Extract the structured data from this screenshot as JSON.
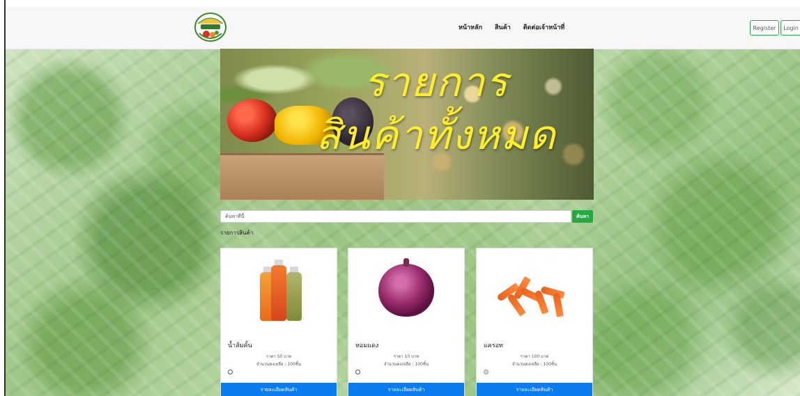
{
  "navbar": {
    "logo_label": "ผักอินทรีย์",
    "links": [
      "หน้าหลัก",
      "สินค้า",
      "ติดต่อเจ้าหน้าที่"
    ],
    "register_label": "Register",
    "login_label": "Login"
  },
  "hero": {
    "title_line1": "รายการ",
    "title_line2": "สินค้าทั้งหมด"
  },
  "search": {
    "placeholder": "ค้นหาที่นี้",
    "button_label": "ค้นหา"
  },
  "section_title": "รายการสินค้า",
  "products": [
    {
      "name": "น้ำส้มคั้น",
      "price": "ราคา 50 บาท",
      "stock": "จำนวนคงเหลือ : 100ชิ้น",
      "button": "รายละเอียดสินค้า"
    },
    {
      "name": "หอมแดง",
      "price": "ราคา 10 บาท",
      "stock": "จำนวนคงเหลือ : 100ชิ้น",
      "button": "รายละเอียดสินค้า"
    },
    {
      "name": "แครอท",
      "price": "ราคา 100 บาท",
      "stock": "จำนวนคงเหลือ : 100ชิ้น",
      "button": "รายละเอียดสินค้า"
    }
  ],
  "colors": {
    "primary_button": "#0a7cf0",
    "success": "#28a745",
    "hero_text": "#ffee2a"
  }
}
